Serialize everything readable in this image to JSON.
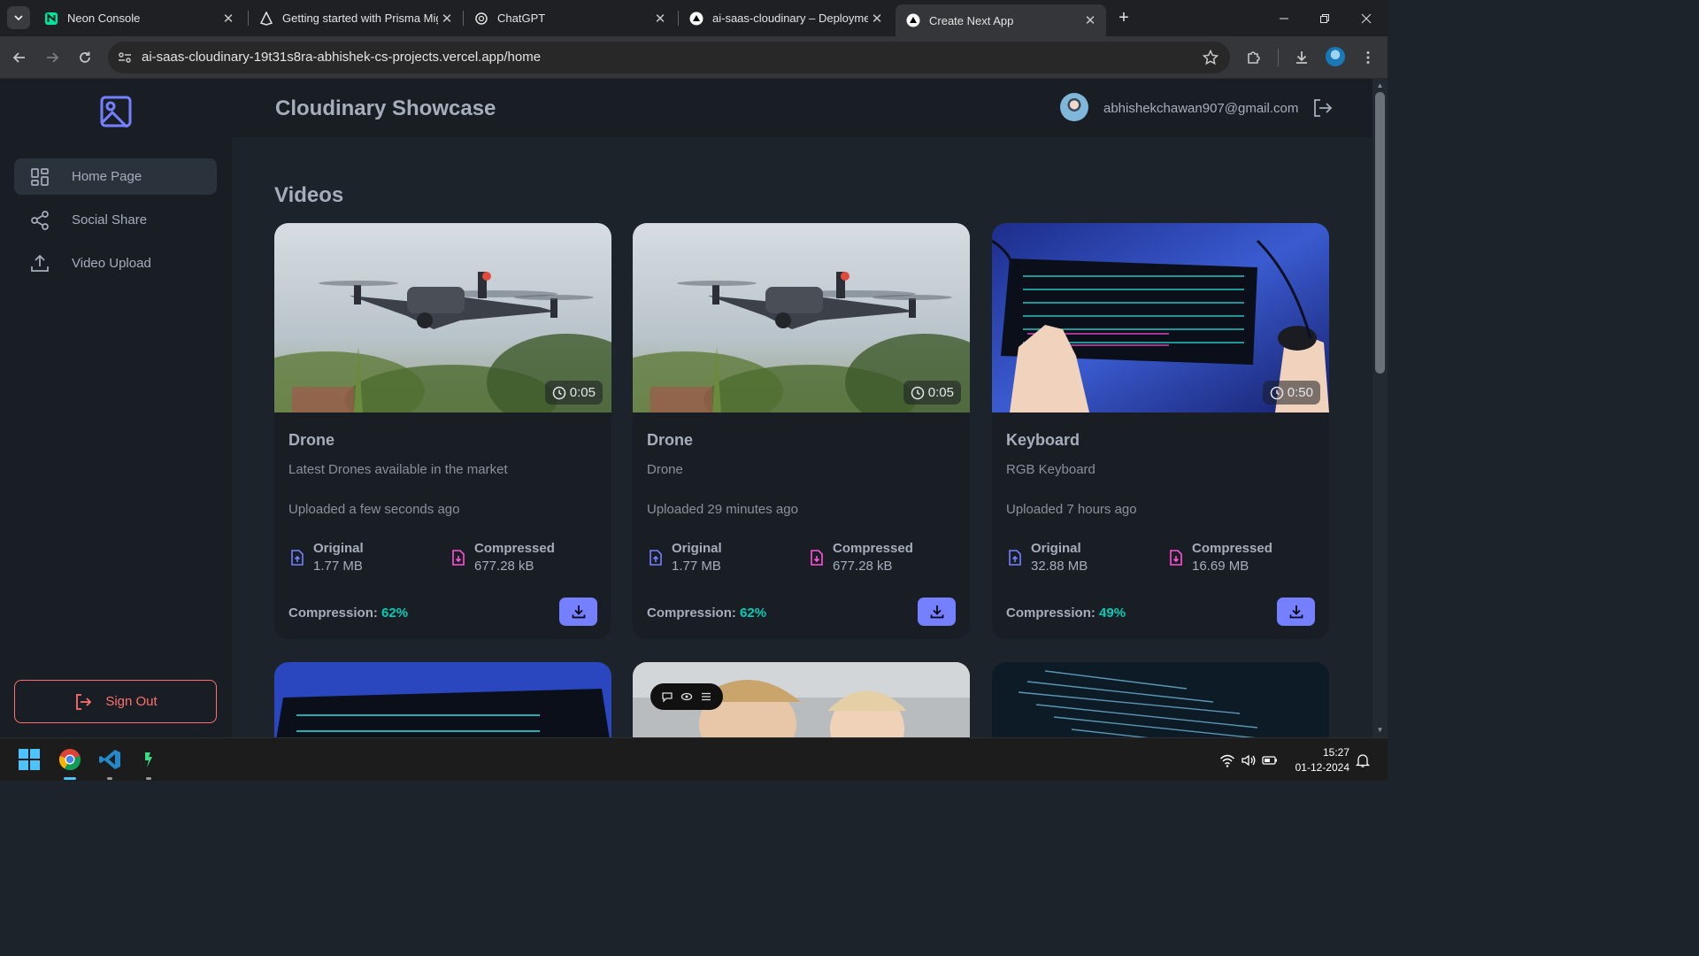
{
  "browser": {
    "tabs": [
      {
        "title": "Neon Console"
      },
      {
        "title": "Getting started with Prisma Mig"
      },
      {
        "title": "ChatGPT"
      },
      {
        "title": "ai-saas-cloudinary – Deploymer"
      },
      {
        "title": "Create Next App"
      }
    ],
    "url": "ai-saas-cloudinary-19t31s8ra-abhishek-cs-projects.vercel.app/home"
  },
  "app": {
    "title": "Cloudinary Showcase",
    "user_email": "abhishekchawan907@gmail.com",
    "sidebar": {
      "items": [
        {
          "label": "Home Page",
          "icon": "grid-icon",
          "active": true
        },
        {
          "label": "Social Share",
          "icon": "share-icon",
          "active": false
        },
        {
          "label": "Video Upload",
          "icon": "upload-icon",
          "active": false
        }
      ],
      "sign_out": "Sign Out"
    },
    "section_title": "Videos",
    "videos": [
      {
        "title": "Drone",
        "description": "Latest Drones available in the market",
        "uploaded": "Uploaded a few seconds ago",
        "duration": "0:05",
        "original_label": "Original",
        "original_size": "1.77 MB",
        "compressed_label": "Compressed",
        "compressed_size": "677.28 kB",
        "compression_label": "Compression:",
        "compression_pct": "62%"
      },
      {
        "title": "Drone",
        "description": "Drone",
        "uploaded": "Uploaded 29 minutes ago",
        "duration": "0:05",
        "original_label": "Original",
        "original_size": "1.77 MB",
        "compressed_label": "Compressed",
        "compressed_size": "677.28 kB",
        "compression_label": "Compression:",
        "compression_pct": "62%"
      },
      {
        "title": "Keyboard",
        "description": "RGB Keyboard",
        "uploaded": "Uploaded 7 hours ago",
        "duration": "0:50",
        "original_label": "Original",
        "original_size": "32.88 MB",
        "compressed_label": "Compressed",
        "compressed_size": "16.69 MB",
        "compression_label": "Compression:",
        "compression_pct": "49%"
      }
    ]
  },
  "colors": {
    "accent": "#7480ff",
    "success": "#00cdb7",
    "danger": "#ff6f6f",
    "compressed_icon": "#ff52d9",
    "original_icon": "#7480ff"
  },
  "taskbar": {
    "time": "15:27",
    "date": "01-12-2024"
  }
}
